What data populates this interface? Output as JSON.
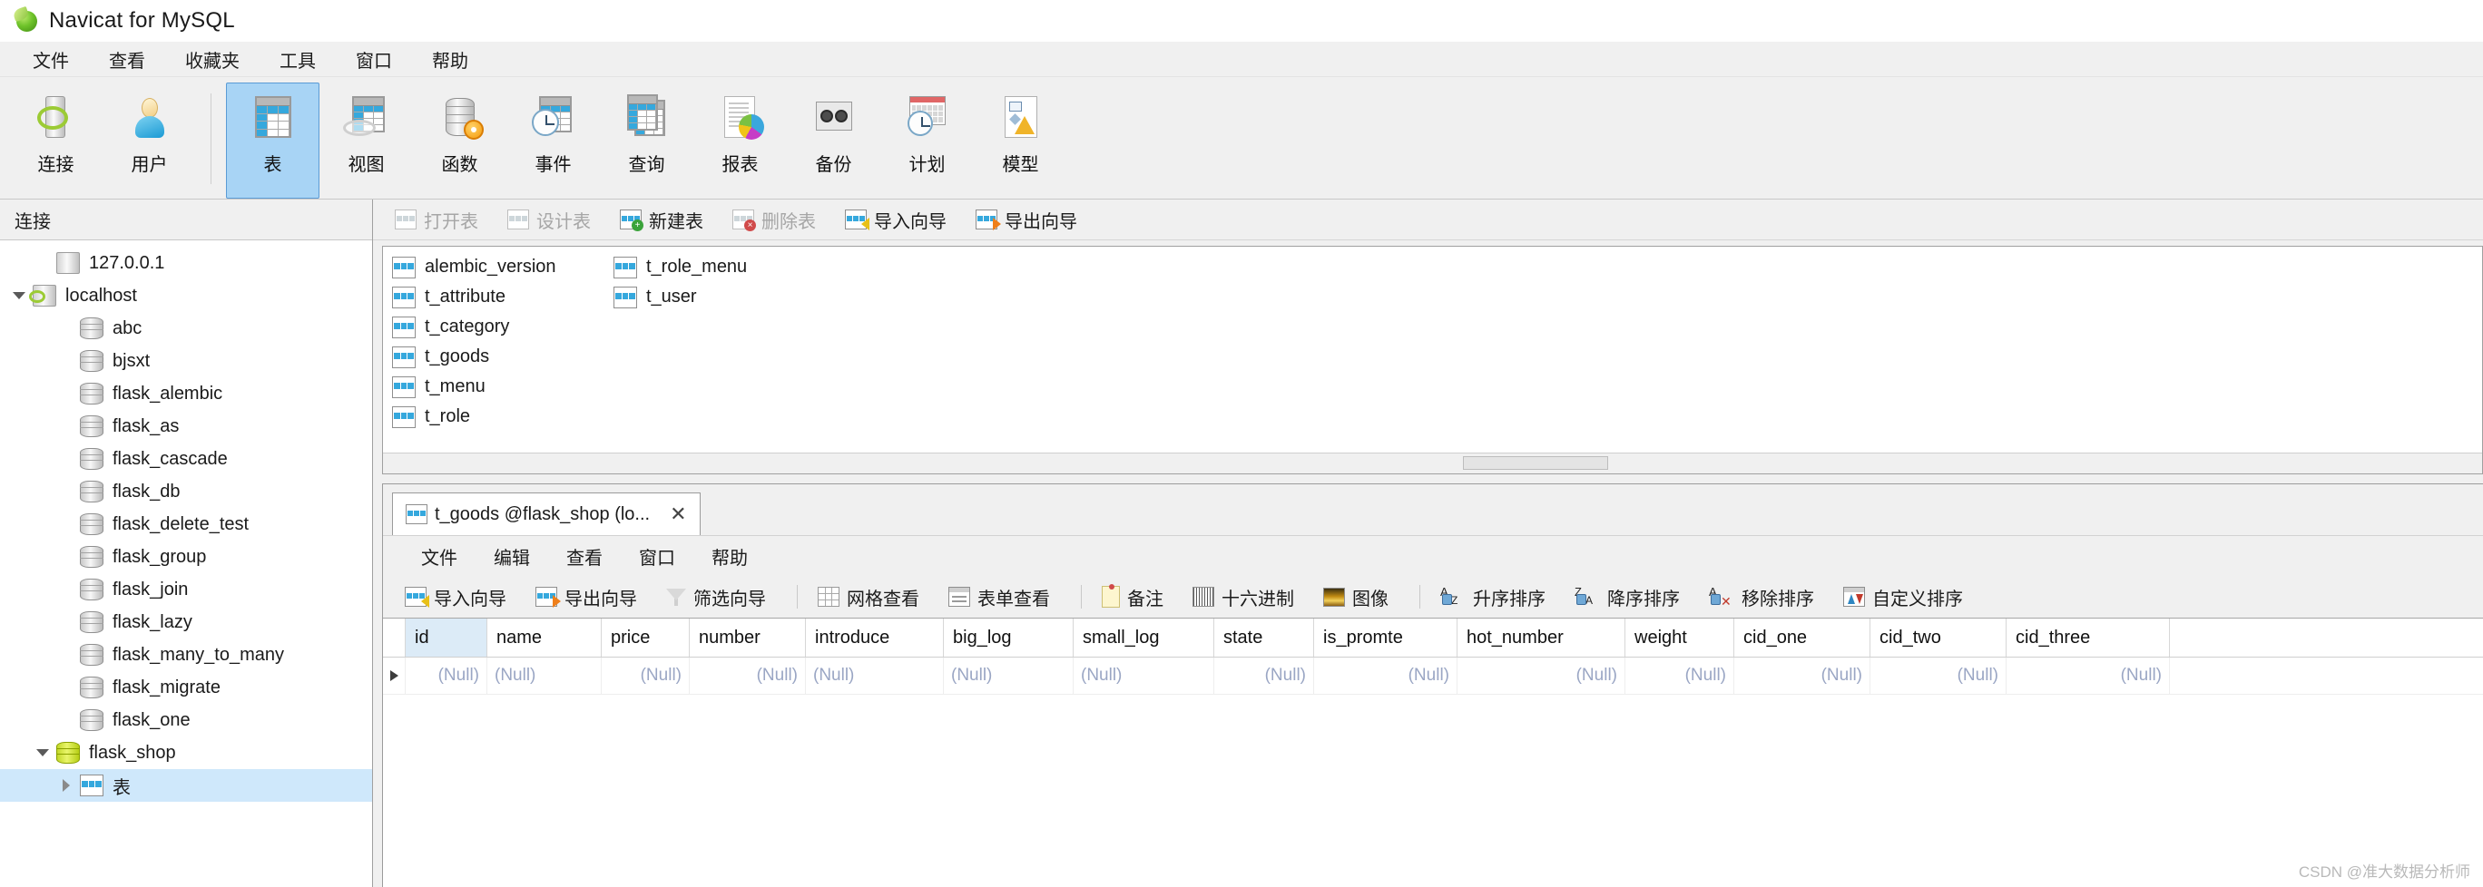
{
  "window": {
    "title": "Navicat for MySQL",
    "app_icon": "navicat-logo-icon"
  },
  "menubar": {
    "items": [
      "文件",
      "查看",
      "收藏夹",
      "工具",
      "窗口",
      "帮助"
    ]
  },
  "toolbar": {
    "items": [
      {
        "label": "连接",
        "icon": "connection-icon",
        "selected": false
      },
      {
        "label": "用户",
        "icon": "user-icon",
        "selected": false
      },
      {
        "label": "表",
        "icon": "table-icon",
        "selected": true
      },
      {
        "label": "视图",
        "icon": "view-icon",
        "selected": false
      },
      {
        "label": "函数",
        "icon": "function-icon",
        "selected": false
      },
      {
        "label": "事件",
        "icon": "event-icon",
        "selected": false
      },
      {
        "label": "查询",
        "icon": "query-icon",
        "selected": false
      },
      {
        "label": "报表",
        "icon": "report-icon",
        "selected": false
      },
      {
        "label": "备份",
        "icon": "backup-icon",
        "selected": false
      },
      {
        "label": "计划",
        "icon": "schedule-icon",
        "selected": false
      },
      {
        "label": "模型",
        "icon": "model-icon",
        "selected": false
      }
    ]
  },
  "sidebar": {
    "header": "连接",
    "tree": [
      {
        "label": "127.0.0.1",
        "icon": "server-icon",
        "indent": 1,
        "expander": "none",
        "selected": false
      },
      {
        "label": "localhost",
        "icon": "server-connected-icon",
        "indent": 0,
        "expander": "down",
        "selected": false
      },
      {
        "label": "abc",
        "icon": "database-icon",
        "indent": 2,
        "expander": "none",
        "selected": false
      },
      {
        "label": "bjsxt",
        "icon": "database-icon",
        "indent": 2,
        "expander": "none",
        "selected": false
      },
      {
        "label": "flask_alembic",
        "icon": "database-icon",
        "indent": 2,
        "expander": "none",
        "selected": false
      },
      {
        "label": "flask_as",
        "icon": "database-icon",
        "indent": 2,
        "expander": "none",
        "selected": false
      },
      {
        "label": "flask_cascade",
        "icon": "database-icon",
        "indent": 2,
        "expander": "none",
        "selected": false
      },
      {
        "label": "flask_db",
        "icon": "database-icon",
        "indent": 2,
        "expander": "none",
        "selected": false
      },
      {
        "label": "flask_delete_test",
        "icon": "database-icon",
        "indent": 2,
        "expander": "none",
        "selected": false
      },
      {
        "label": "flask_group",
        "icon": "database-icon",
        "indent": 2,
        "expander": "none",
        "selected": false
      },
      {
        "label": "flask_join",
        "icon": "database-icon",
        "indent": 2,
        "expander": "none",
        "selected": false
      },
      {
        "label": "flask_lazy",
        "icon": "database-icon",
        "indent": 2,
        "expander": "none",
        "selected": false
      },
      {
        "label": "flask_many_to_many",
        "icon": "database-icon",
        "indent": 2,
        "expander": "none",
        "selected": false
      },
      {
        "label": "flask_migrate",
        "icon": "database-icon",
        "indent": 2,
        "expander": "none",
        "selected": false
      },
      {
        "label": "flask_one",
        "icon": "database-icon",
        "indent": 2,
        "expander": "none",
        "selected": false
      },
      {
        "label": "flask_shop",
        "icon": "database-open-icon",
        "indent": 1,
        "expander": "down",
        "selected": false
      },
      {
        "label": "表",
        "icon": "table-icon",
        "indent": 2,
        "expander": "right",
        "selected": true
      }
    ]
  },
  "subtoolbar": {
    "buttons": [
      {
        "label": "打开表",
        "icon": "open-table-icon",
        "disabled": true
      },
      {
        "label": "设计表",
        "icon": "design-table-icon",
        "disabled": true
      },
      {
        "label": "新建表",
        "icon": "new-table-icon",
        "disabled": false
      },
      {
        "label": "删除表",
        "icon": "delete-table-icon",
        "disabled": true
      },
      {
        "label": "导入向导",
        "icon": "import-wizard-icon",
        "disabled": false
      },
      {
        "label": "导出向导",
        "icon": "export-wizard-icon",
        "disabled": false
      }
    ]
  },
  "table_list": {
    "items": [
      "alembic_version",
      "t_attribute",
      "t_category",
      "t_goods",
      "t_menu",
      "t_role",
      "t_role_menu",
      "t_user"
    ]
  },
  "editor": {
    "tab": {
      "label": "t_goods @flask_shop (lo...",
      "icon": "table-icon",
      "close": "✕"
    },
    "menubar": {
      "items": [
        "文件",
        "编辑",
        "查看",
        "窗口",
        "帮助"
      ]
    },
    "toolbar": {
      "groups": [
        [
          {
            "label": "导入向导",
            "icon": "import-wizard-icon"
          },
          {
            "label": "导出向导",
            "icon": "export-wizard-icon"
          },
          {
            "label": "筛选向导",
            "icon": "filter-wizard-icon"
          }
        ],
        [
          {
            "label": "网格查看",
            "icon": "grid-view-icon"
          },
          {
            "label": "表单查看",
            "icon": "form-view-icon"
          }
        ],
        [
          {
            "label": "备注",
            "icon": "memo-icon"
          },
          {
            "label": "十六进制",
            "icon": "hex-icon"
          },
          {
            "label": "图像",
            "icon": "image-icon"
          }
        ],
        [
          {
            "label": "升序排序",
            "icon": "sort-ascending-icon"
          },
          {
            "label": "降序排序",
            "icon": "sort-descending-icon"
          },
          {
            "label": "移除排序",
            "icon": "remove-sort-icon"
          },
          {
            "label": "自定义排序",
            "icon": "custom-sort-icon"
          }
        ]
      ]
    },
    "grid": {
      "columns": [
        {
          "name": "id",
          "width": 90,
          "align": "r",
          "selected": true
        },
        {
          "name": "name",
          "width": 126,
          "align": "l",
          "selected": false
        },
        {
          "name": "price",
          "width": 97,
          "align": "r",
          "selected": false
        },
        {
          "name": "number",
          "width": 128,
          "align": "r",
          "selected": false
        },
        {
          "name": "introduce",
          "width": 152,
          "align": "l",
          "selected": false
        },
        {
          "name": "big_log",
          "width": 143,
          "align": "l",
          "selected": false
        },
        {
          "name": "small_log",
          "width": 155,
          "align": "l",
          "selected": false
        },
        {
          "name": "state",
          "width": 110,
          "align": "r",
          "selected": false
        },
        {
          "name": "is_promte",
          "width": 158,
          "align": "r",
          "selected": false
        },
        {
          "name": "hot_number",
          "width": 185,
          "align": "r",
          "selected": false
        },
        {
          "name": "weight",
          "width": 120,
          "align": "r",
          "selected": false
        },
        {
          "name": "cid_one",
          "width": 150,
          "align": "r",
          "selected": false
        },
        {
          "name": "cid_two",
          "width": 150,
          "align": "r",
          "selected": false
        },
        {
          "name": "cid_three",
          "width": 180,
          "align": "r",
          "selected": false
        }
      ],
      "rows": [
        [
          "(Null)",
          "(Null)",
          "(Null)",
          "(Null)",
          "(Null)",
          "(Null)",
          "(Null)",
          "(Null)",
          "(Null)",
          "(Null)",
          "(Null)",
          "(Null)",
          "(Null)",
          "(Null)"
        ]
      ]
    }
  },
  "watermark": "CSDN @准大数据分析师",
  "colors": {
    "accent": "#35a8dd",
    "selection": "#a8d4f5",
    "tree_selection": "#cfe8fb",
    "null_text": "#9aa6c4",
    "chrome": "#f0f0f0"
  }
}
